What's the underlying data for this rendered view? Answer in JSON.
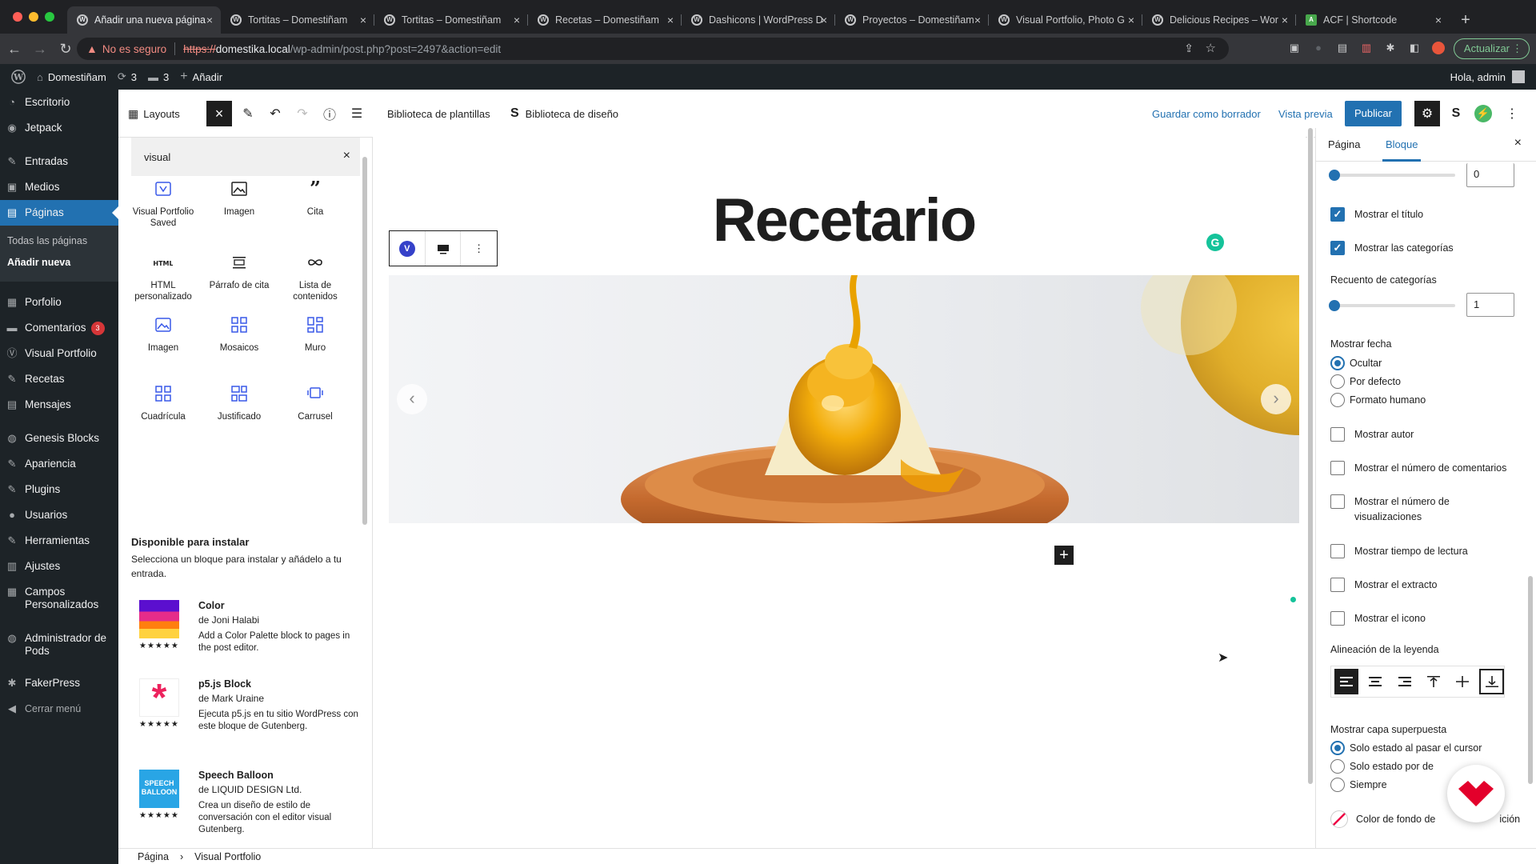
{
  "browser": {
    "tabs": [
      {
        "label": "Añadir una nueva página"
      },
      {
        "label": "Tortitas – Domestiñam"
      },
      {
        "label": "Tortitas – Domestiñam"
      },
      {
        "label": "Recetas – Domestiñam"
      },
      {
        "label": "Dashicons | WordPress D"
      },
      {
        "label": "Proyectos – Domestiñam"
      },
      {
        "label": "Visual Portfolio, Photo G"
      },
      {
        "label": "Delicious Recipes – Wor"
      },
      {
        "label": "ACF | Shortcode"
      }
    ],
    "new_tab": "+",
    "not_secure": "No es seguro",
    "url_scheme": "https://",
    "url_host": "domestika.local",
    "url_path": "/wp-admin/post.php?post=2497&action=edit",
    "update_label": "Actualizar"
  },
  "adminbar": {
    "site_name": "Domestiñam",
    "updates_count": "3",
    "comments_count": "3",
    "new_label": "Añadir",
    "greeting": "Hola, admin"
  },
  "sidebar": {
    "items": [
      {
        "label": "Escritorio",
        "icon": "dashboard-icon"
      },
      {
        "label": "Jetpack",
        "icon": "jetpack-icon"
      },
      {
        "label": "Entradas",
        "icon": "pin-icon"
      },
      {
        "label": "Medios",
        "icon": "media-icon"
      },
      {
        "label": "Páginas",
        "icon": "pages-icon"
      },
      {
        "label": "Porfolio",
        "icon": "portfolio-icon"
      },
      {
        "label": "Comentarios",
        "icon": "comments-icon",
        "badge": "3"
      },
      {
        "label": "Visual Portfolio",
        "icon": "visual-portfolio-icon"
      },
      {
        "label": "Recetas",
        "icon": "recipes-icon"
      },
      {
        "label": "Mensajes",
        "icon": "messages-icon"
      },
      {
        "label": "Genesis Blocks",
        "icon": "genesis-icon"
      },
      {
        "label": "Apariencia",
        "icon": "appearance-icon"
      },
      {
        "label": "Plugins",
        "icon": "plugins-icon"
      },
      {
        "label": "Usuarios",
        "icon": "users-icon"
      },
      {
        "label": "Herramientas",
        "icon": "tools-icon"
      },
      {
        "label": "Ajustes",
        "icon": "settings-icon"
      },
      {
        "label": "Campos Personalizados",
        "icon": "custom-fields-icon"
      },
      {
        "label": "Administrador de Pods",
        "icon": "pods-icon"
      },
      {
        "label": "FakerPress",
        "icon": "fakerpress-icon"
      },
      {
        "label": "Cerrar menú",
        "icon": "collapse-icon"
      }
    ],
    "submenu": [
      "Todas las páginas",
      "Añadir nueva"
    ]
  },
  "toolbar": {
    "layouts": "Layouts",
    "template_library": "Biblioteca de plantillas",
    "design_library": "Biblioteca de diseño",
    "save_draft": "Guardar como borrador",
    "preview": "Vista previa",
    "publish": "Publicar"
  },
  "inserter": {
    "search_value": "visual",
    "blocks": [
      {
        "label": "Visual Portfolio Saved",
        "icon": "visual-portfolio-saved-icon"
      },
      {
        "label": "Imagen",
        "icon": "image-icon"
      },
      {
        "label": "Cita",
        "icon": "quote-icon"
      },
      {
        "label": "HTML personalizado",
        "icon": "html-icon",
        "glyph": "HTML"
      },
      {
        "label": "Párrafo de cita",
        "icon": "pullquote-icon"
      },
      {
        "label": "Lista de contenidos",
        "icon": "infinity-icon"
      },
      {
        "label": "Imagen",
        "icon": "vp-image-icon"
      },
      {
        "label": "Mosaicos",
        "icon": "tiles-icon"
      },
      {
        "label": "Muro",
        "icon": "masonry-icon"
      },
      {
        "label": "Cuadrícula",
        "icon": "grid-icon"
      },
      {
        "label": "Justificado",
        "icon": "justified-icon"
      },
      {
        "label": "Carrusel",
        "icon": "carousel-icon"
      }
    ],
    "install_title": "Disponible para instalar",
    "install_desc": "Selecciona un bloque para instalar y añádelo a tu entrada.",
    "plugins": [
      {
        "name": "Color",
        "author": "de Joni Halabi",
        "desc": "Add a Color Palette block to pages in the post editor.",
        "stars": "★★★★★"
      },
      {
        "name": "p5.js Block",
        "author": "de Mark Uraine",
        "desc": "Ejecuta p5.js en tu sitio WordPress con este bloque de Gutenberg.",
        "stars": "★★★★★"
      },
      {
        "name": "Speech Balloon",
        "author": "de LIQUID DESIGN Ltd.",
        "desc": "Crea un diseño de estilo de conversación con el editor visual Gutenberg.",
        "stars": "★★★★★",
        "thumb_text": "SPEECH BALLOON"
      }
    ]
  },
  "canvas": {
    "title": "Recetario",
    "block_icon_letter": "V"
  },
  "settings": {
    "tabs": [
      "Página",
      "Bloque"
    ],
    "top_value": "0",
    "show_title": "Mostrar el título",
    "show_categories": "Mostrar las categorías",
    "category_count_label": "Recuento de categorías",
    "category_count_value": "1",
    "show_date_label": "Mostrar fecha",
    "date_options": [
      "Ocultar",
      "Por defecto",
      "Formato humano"
    ],
    "checkboxes": [
      "Mostrar autor",
      "Mostrar el número de comentarios",
      "Mostrar el número de visualizaciones",
      "Mostrar tiempo de lectura",
      "Mostrar el extracto",
      "Mostrar el icono"
    ],
    "caption_align_label": "Alineación de la leyenda",
    "overlay_label": "Mostrar capa superpuesta",
    "overlay_options": [
      "Solo estado al pasar el cursor",
      "Solo estado por de",
      "Siempre"
    ],
    "bg_color_label": "Color de fondo de",
    "bg_color_suffix": "ición"
  },
  "breadcrumbs": [
    "Página",
    "Visual Portfolio"
  ],
  "colors": {
    "wp_blue": "#2271b1",
    "admin_dark": "#1d2327",
    "grammarly": "#15c39a",
    "domestika_red": "#e3002b"
  }
}
